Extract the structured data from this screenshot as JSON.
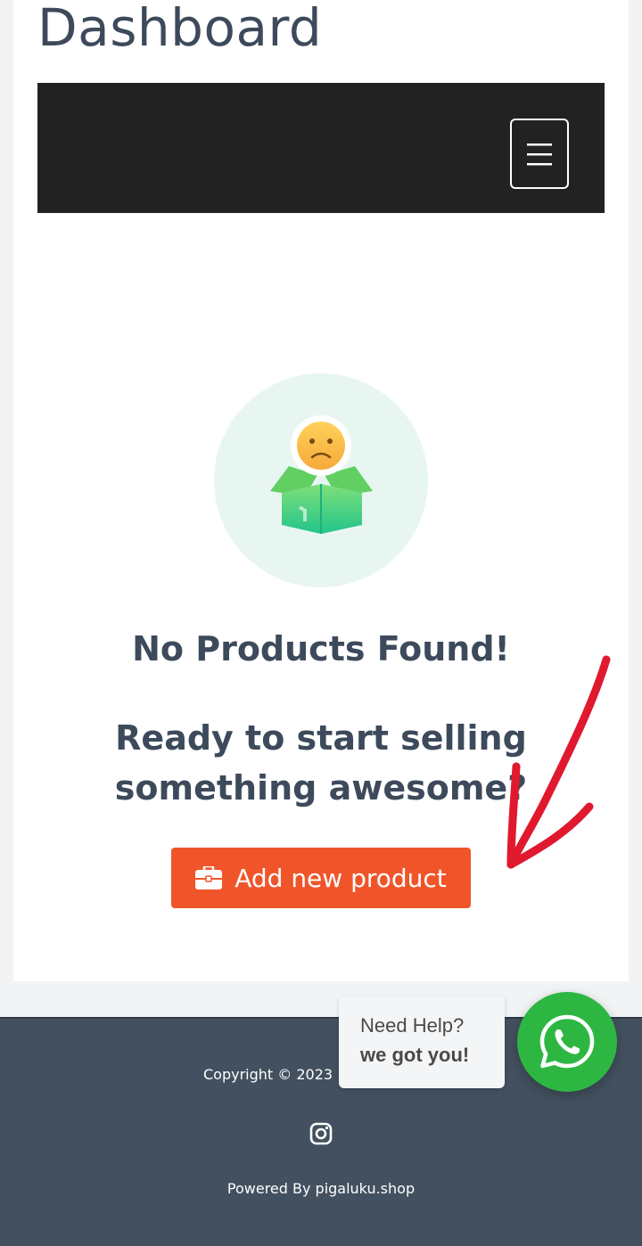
{
  "page": {
    "title": "Dashboard"
  },
  "navbar": {
    "menu_icon": "hamburger-icon"
  },
  "empty_state": {
    "illustration_icon": "sad-empty-box-icon",
    "title": "No Products Found!",
    "subtitle": "Ready to start selling something awesome?",
    "add_button": {
      "label": "Add new product",
      "icon": "briefcase-icon",
      "color": "#f0552a"
    }
  },
  "footer": {
    "copyright": "Copyright © 2023 |",
    "social_icon": "instagram-icon",
    "powered_by": "Powered By pigaluku.shop"
  },
  "help_widget": {
    "line1": "Need Help?",
    "line2": "we got you!",
    "icon": "whatsapp-icon",
    "color": "#2db742"
  }
}
